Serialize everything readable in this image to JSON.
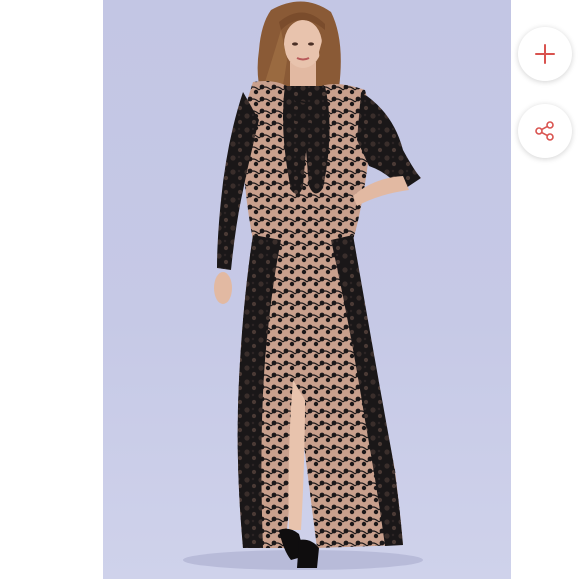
{
  "product_image": {
    "alt": "",
    "colors": {
      "backdrop": "#c4c7e5",
      "dress": "#1a1718",
      "skin": "#e2b9a2",
      "hair": "#8a5a36"
    }
  },
  "actions": {
    "add": {
      "icon": "plus-icon",
      "color": "#d9534f"
    },
    "share": {
      "icon": "share-icon",
      "color": "#d9534f"
    }
  }
}
